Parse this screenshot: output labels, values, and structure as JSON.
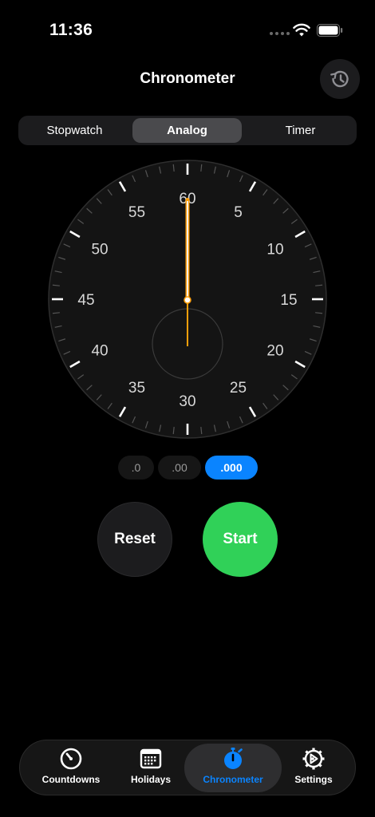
{
  "status_bar": {
    "time": "11:36",
    "icons": [
      "cellular-dots-icon",
      "wifi-icon",
      "battery-icon"
    ]
  },
  "header": {
    "title": "Chronometer",
    "history_icon": "history-clock-icon"
  },
  "segmented_control": {
    "items": [
      {
        "label": "Stopwatch",
        "selected": false
      },
      {
        "label": "Analog",
        "selected": true
      },
      {
        "label": "Timer",
        "selected": false
      }
    ]
  },
  "dial": {
    "numbers": [
      "60",
      "5",
      "10",
      "15",
      "20",
      "25",
      "30",
      "35",
      "40",
      "45",
      "50",
      "55"
    ],
    "hand_seconds": 0
  },
  "precision": {
    "options": [
      {
        "label": ".0",
        "selected": false
      },
      {
        "label": ".00",
        "selected": false
      },
      {
        "label": ".000",
        "selected": true
      }
    ]
  },
  "actions": {
    "reset_label": "Reset",
    "start_label": "Start"
  },
  "tabbar": {
    "items": [
      {
        "label": "Countdowns",
        "icon": "countdown-timer-icon",
        "active": false
      },
      {
        "label": "Holidays",
        "icon": "calendar-icon",
        "active": false
      },
      {
        "label": "Chronometer",
        "icon": "stopwatch-icon",
        "active": true
      },
      {
        "label": "Settings",
        "icon": "gear-icon",
        "active": false
      }
    ]
  },
  "colors": {
    "accent": "#0a84ff",
    "start_green": "#30d158",
    "hand_orange": "#ff9f0a",
    "background": "#000000"
  }
}
